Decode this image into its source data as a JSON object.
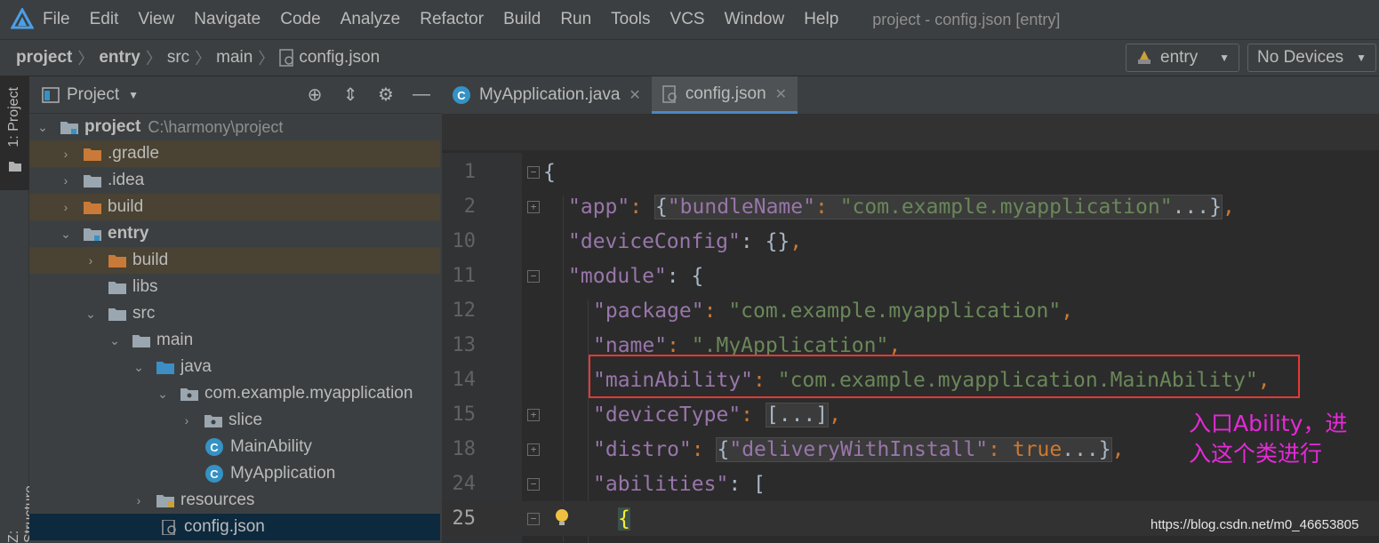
{
  "menubar": {
    "items": [
      "File",
      "Edit",
      "View",
      "Navigate",
      "Code",
      "Analyze",
      "Refactor",
      "Build",
      "Run",
      "Tools",
      "VCS",
      "Window",
      "Help"
    ],
    "title": "project - config.json [entry]"
  },
  "breadcrumb": {
    "items": [
      "project",
      "entry",
      "src",
      "main",
      "config.json"
    ]
  },
  "run_config": {
    "module": "entry",
    "devices": "No Devices"
  },
  "toolstrip": {
    "project": "1: Project",
    "structure": "Z: Structure"
  },
  "project_panel": {
    "title": "Project",
    "tree": [
      {
        "label": "project",
        "path": "C:\\harmony\\project"
      },
      {
        "label": ".gradle"
      },
      {
        "label": ".idea"
      },
      {
        "label": "build"
      },
      {
        "label": "entry"
      },
      {
        "label": "build"
      },
      {
        "label": "libs"
      },
      {
        "label": "src"
      },
      {
        "label": "main"
      },
      {
        "label": "java"
      },
      {
        "label": "com.example.myapplication"
      },
      {
        "label": "slice"
      },
      {
        "label": "MainAbility"
      },
      {
        "label": "MyApplication"
      },
      {
        "label": "resources"
      },
      {
        "label": "config.json"
      }
    ]
  },
  "tabs": [
    {
      "label": "MyApplication.java"
    },
    {
      "label": "config.json"
    }
  ],
  "editor": {
    "line_numbers": [
      "1",
      "2",
      "10",
      "11",
      "12",
      "13",
      "14",
      "15",
      "18",
      "24",
      "25"
    ],
    "current_line": "25"
  },
  "code": {
    "l1_brace": "{",
    "l2_key": "\"app\"",
    "l2_colon": ": ",
    "l2_open": "{",
    "l2_inner_key": "\"bundleName\"",
    "l2_inner_colon": ": ",
    "l2_inner_val": "\"com.example.myapplication\"",
    "l2_dots": "...",
    "l2_close": "}",
    "l2_comma": ",",
    "l10_key": "\"deviceConfig\"",
    "l10_rest": ": {}",
    "l10_comma": ",",
    "l11_key": "\"module\"",
    "l11_rest": ": {",
    "l12_key": "\"package\"",
    "l12_colon": ": ",
    "l12_val": "\"com.example.myapplication\"",
    "l12_comma": ",",
    "l13_key": "\"name\"",
    "l13_colon": ": ",
    "l13_val": "\".MyApplication\"",
    "l13_comma": ",",
    "l14_key": "\"mainAbility\"",
    "l14_colon": ": ",
    "l14_val": "\"com.example.myapplication.MainAbility\"",
    "l14_comma": ",",
    "l15_key": "\"deviceType\"",
    "l15_colon": ": ",
    "l15_fold": "[...]",
    "l15_comma": ",",
    "l18_key": "\"distro\"",
    "l18_colon": ": ",
    "l18_open": "{",
    "l18_inner_key": "\"deliveryWithInstall\"",
    "l18_inner_colon": ": ",
    "l18_inner_val": "true",
    "l18_dots": "...",
    "l18_close": "}",
    "l18_comma": ",",
    "l24_key": "\"abilities\"",
    "l24_rest": ": [",
    "l25_brace": "{"
  },
  "annotation": {
    "line1": "入口Ability，进",
    "line2": "入这个类进行"
  },
  "watermark": "https://blog.csdn.net/m0_46653805",
  "colors": {
    "key": "#9876aa",
    "string": "#6a8759",
    "punct": "#cc7832",
    "highlight_box": "#e53935",
    "annotation": "#e629d8"
  }
}
